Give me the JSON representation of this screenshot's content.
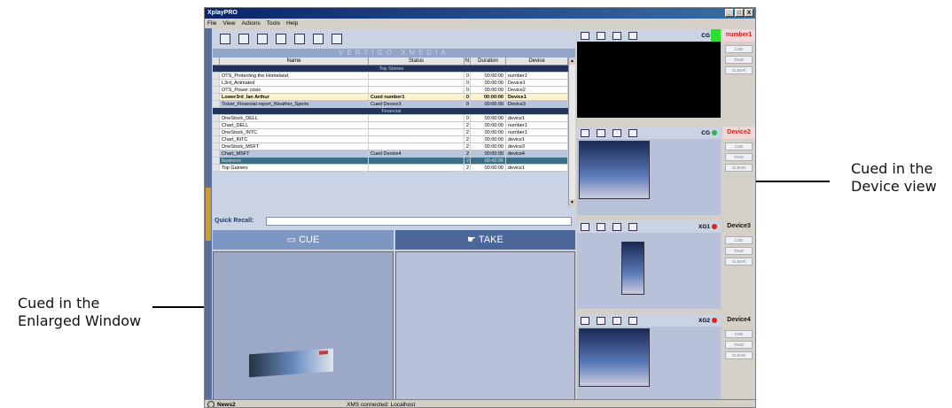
{
  "window": {
    "title": "XplayPRO",
    "controls": [
      "_",
      "□",
      "X"
    ]
  },
  "menu": [
    "File",
    "View",
    "Actions",
    "Tools",
    "Help"
  ],
  "brand_bar": "VERTIGO XMEDIA",
  "table": {
    "headers": [
      "Name",
      "Status",
      "N",
      "Duration",
      "Device"
    ],
    "rows": [
      {
        "type": "group",
        "name": "Top Stories"
      },
      {
        "name": "OTS_Protecting the Homeland",
        "status": "",
        "n": "0",
        "duration": "00:00:00",
        "device": "number1"
      },
      {
        "name": "L3rd_Animated",
        "status": "",
        "n": "0",
        "duration": "00:00:00",
        "device": "Device1"
      },
      {
        "name": "OTS_Power crisis",
        "status": "",
        "n": "0",
        "duration": "00:00:00",
        "device": "Device2"
      },
      {
        "type": "cued",
        "name": "Lower3rd_Ian Arthur",
        "status": "Cued number1",
        "n": "0",
        "duration": "00:00:00",
        "device": "Device1"
      },
      {
        "type": "selected",
        "name": "Ticker_Financial report_Weather_Sports",
        "status": "Cued Device3",
        "n": "0",
        "duration": "00:00:00",
        "device": "Device3"
      },
      {
        "type": "group",
        "name": "Financial"
      },
      {
        "name": "OneStock_DELL",
        "status": "",
        "n": "0",
        "duration": "00:00:00",
        "device": "device1"
      },
      {
        "name": "Chart_DELL",
        "status": "",
        "n": "2",
        "duration": "00:00:00",
        "device": "number1"
      },
      {
        "name": "OneStock_INTC",
        "status": "",
        "n": "2",
        "duration": "00:00:00",
        "device": "number1"
      },
      {
        "name": "Chart_INTC",
        "status": "",
        "n": "2",
        "duration": "00:00:00",
        "device": "device1"
      },
      {
        "name": "OneStock_MSFT",
        "status": "",
        "n": "2",
        "duration": "00:00:00",
        "device": "device3"
      },
      {
        "type": "selected",
        "name": "Chart_MSFT",
        "status": "Cued Device4",
        "n": "2",
        "duration": "00:00:00",
        "device": "device4"
      },
      {
        "type": "hl",
        "name": "business",
        "status": "",
        "n": "2",
        "duration": "00:42:06",
        "device": ""
      },
      {
        "name": "Top Gainers",
        "status": "",
        "n": "2",
        "duration": "00:00:00",
        "device": "device1"
      }
    ]
  },
  "quick_recall": {
    "label": "Quick Recall:",
    "value": ""
  },
  "cue_label": "CUE",
  "take_label": "TAKE",
  "devices": [
    {
      "name": "number1",
      "channel": "CG",
      "name_color": "#cc2222",
      "name_bg": "#f1d7d7",
      "dot": "#2fb24a",
      "buttons": [
        "CUE",
        "TAKE",
        "CLEAR"
      ]
    },
    {
      "name": "Device2",
      "channel": "CG",
      "name_color": "#cc2222",
      "name_bg": "#f1d7d7",
      "dot": "#2fb24a",
      "buttons": [
        "CUE",
        "TAKE",
        "CLEAR"
      ]
    },
    {
      "name": "Device3",
      "channel": "XG1",
      "name_color": "#111111",
      "name_bg": "#d4d0c8",
      "dot": "#d22",
      "buttons": [
        "CUE",
        "TAKE",
        "CLEAR"
      ]
    },
    {
      "name": "Device4",
      "channel": "XG2",
      "name_color": "#111111",
      "name_bg": "#d4d0c8",
      "dot": "#d22",
      "buttons": [
        "CUE",
        "TAKE",
        "CLEAR"
      ]
    }
  ],
  "status": {
    "profile": "News2",
    "connection": "XMS connected: Localhost"
  },
  "annotations": {
    "enlarged": [
      "Cued in the",
      "Enlarged Window"
    ],
    "device": [
      "Cued in the",
      "Device view"
    ]
  }
}
